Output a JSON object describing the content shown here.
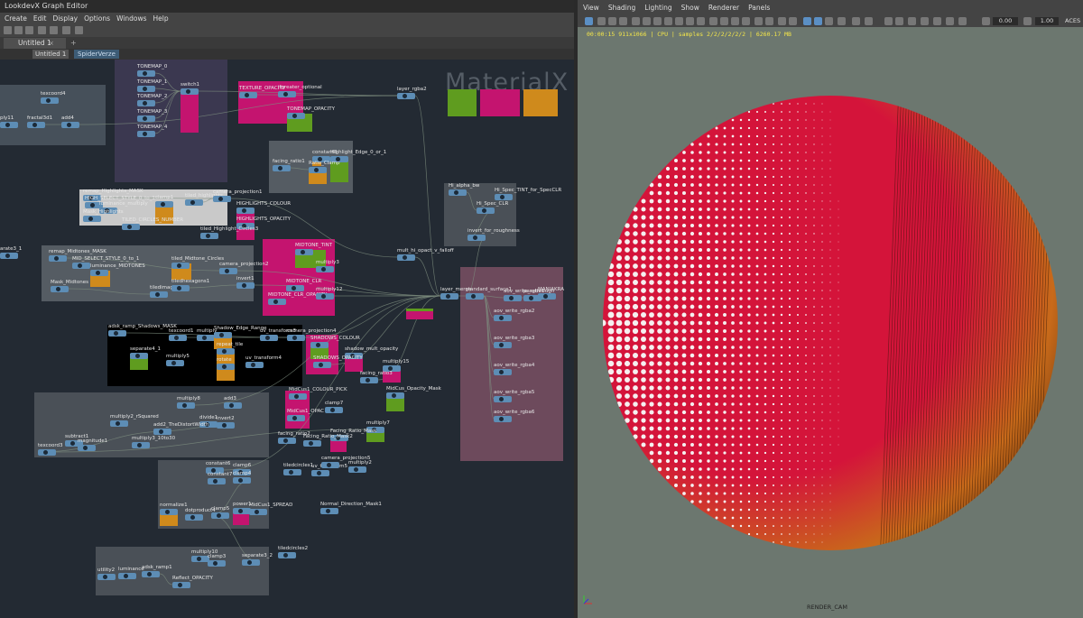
{
  "editor": {
    "window_title": "LookdevX Graph Editor",
    "menu": [
      "Create",
      "Edit",
      "Display",
      "Options",
      "Windows",
      "Help"
    ],
    "tab_label": "Untitled 1",
    "tab_close": "×",
    "tab_add": "+",
    "breadcrumb": [
      "Untitled 1",
      "SpiderVerze"
    ],
    "watermark": "MaterialX"
  },
  "graph": {
    "backdrops": [
      {
        "name": "upper-left",
        "color": "#46505a"
      },
      {
        "name": "tonemap",
        "color": "#3b3850"
      },
      {
        "name": "texture-opacity",
        "color": "#c4146f"
      },
      {
        "name": "highlight-edge",
        "color": "#555c63"
      },
      {
        "name": "highlights-mask",
        "color": "#c9c9c9"
      },
      {
        "name": "midtones",
        "color": "#555c63"
      },
      {
        "name": "midtone-tint",
        "color": "#c4146f"
      },
      {
        "name": "shadows-mask",
        "color": "#000000"
      },
      {
        "name": "shadows-colour",
        "color": "#c4146f"
      },
      {
        "name": "multiply-group",
        "color": "#4a5057"
      },
      {
        "name": "midcus-colour",
        "color": "#c4146f"
      },
      {
        "name": "constant-group",
        "color": "#4a5057"
      },
      {
        "name": "spec-group",
        "color": "#4a5057"
      },
      {
        "name": "aov-group",
        "color": "#6d4a5c"
      },
      {
        "name": "reflect-group",
        "color": "#4a5057"
      }
    ],
    "nodes": [
      {
        "label": "texcoord4"
      },
      {
        "label": "ply11"
      },
      {
        "label": "fractal3d1"
      },
      {
        "label": "add4"
      },
      {
        "label": "TONEMAP_0"
      },
      {
        "label": "TONEMAP_1"
      },
      {
        "label": "TONEMAP_2"
      },
      {
        "label": "TONEMAP_3"
      },
      {
        "label": "TONEMAP_4"
      },
      {
        "label": "switch1"
      },
      {
        "label": "TEXTURE_OPACITY"
      },
      {
        "label": "ifgreater_optional"
      },
      {
        "label": "TONEMAP_OPACITY"
      },
      {
        "label": "layer_rgba2"
      },
      {
        "label": "constant8"
      },
      {
        "label": "Highlight_Edge_0_or_1"
      },
      {
        "label": "facing_ratio1"
      },
      {
        "label": "Ratio_Clamp"
      },
      {
        "label": "remap_Highlights_MASK"
      },
      {
        "label": "HIGH_SELECT_STYLE_0_to_1"
      },
      {
        "label": "luminance_multiply"
      },
      {
        "label": "clamp1"
      },
      {
        "label": "Mask_Highlights"
      },
      {
        "label": "TILED_CIRCLES_NUMBER"
      },
      {
        "label": "tiled_highlights"
      },
      {
        "label": "camera_projection1"
      },
      {
        "label": "HIGHLIGHTS_COLOUR"
      },
      {
        "label": "HIGHLIGHTS_OPACITY"
      },
      {
        "label": "tiled_Highlight_Circles3"
      },
      {
        "label": "Hi_alpha_bw"
      },
      {
        "label": "Hi_Spec_TINT_for_SpecCLR"
      },
      {
        "label": "Hi_Spec_CLR"
      },
      {
        "label": "invert_for_roughness"
      },
      {
        "label": "arate3_1"
      },
      {
        "label": "remap_Midtones_MASK"
      },
      {
        "label": "MID_SELECT_STYLE_0_to_1"
      },
      {
        "label": "luminance_MIDTONES"
      },
      {
        "label": "tiled_Midtone_Circles"
      },
      {
        "label": "camera_projection2"
      },
      {
        "label": "Mask_Midtones"
      },
      {
        "label": "tiledimage1"
      },
      {
        "label": "tiledhexagons1"
      },
      {
        "label": "invert1"
      },
      {
        "label": "MIDTONE_TINT"
      },
      {
        "label": "multiply3"
      },
      {
        "label": "MIDTONE_CLR"
      },
      {
        "label": "MIDTONE_CLR_OPACITY"
      },
      {
        "label": "multiply12"
      },
      {
        "label": "mult_hi_opact_v_falloff"
      },
      {
        "label": "layer_merge"
      },
      {
        "label": "standard_surface1"
      },
      {
        "label": "aov_write_rgba1"
      },
      {
        "label": "passthrough"
      },
      {
        "label": "MANIAKRA"
      },
      {
        "label": "aov_write_rgba2"
      },
      {
        "label": "aov_write_rgba3"
      },
      {
        "label": "aov_write_rgba4"
      },
      {
        "label": "aov_write_rgba5"
      },
      {
        "label": "aov_write_rgba6"
      },
      {
        "label": "adsk_ramp_Shadows_MASK"
      },
      {
        "label": "texcoord1"
      },
      {
        "label": "multiply"
      },
      {
        "label": "Shadow_Edge_Range"
      },
      {
        "label": "repeat_tile"
      },
      {
        "label": "uv_transform3"
      },
      {
        "label": "camera_projection4"
      },
      {
        "label": "separate4_1"
      },
      {
        "label": "multiply5"
      },
      {
        "label": "rotate"
      },
      {
        "label": "uv_transform4"
      },
      {
        "label": "SHADOWS_COLOUR"
      },
      {
        "label": "shadow_mult_opacity"
      },
      {
        "label": "SHADOWS_OPACITY"
      },
      {
        "label": "multiply15"
      },
      {
        "label": "facing_ratio3"
      },
      {
        "label": "MidCus_Opacity_Mask"
      },
      {
        "label": "multiply8"
      },
      {
        "label": "add3"
      },
      {
        "label": "multiply2_rSquared"
      },
      {
        "label": "divide1"
      },
      {
        "label": "invert2"
      },
      {
        "label": "add2_TheDistortWidth"
      },
      {
        "label": "subtract1"
      },
      {
        "label": "magnitude1"
      },
      {
        "label": "multiply3_10to30"
      },
      {
        "label": "texcoord3"
      },
      {
        "label": "MidCus1_COLOUR_PICK"
      },
      {
        "label": "clamp7"
      },
      {
        "label": "MidCus1_OPAC"
      },
      {
        "label": "multiply7"
      },
      {
        "label": "Facing_Ratio_Mask"
      },
      {
        "label": "facing_ratio2"
      },
      {
        "label": "Facing_Ratio_Mask2"
      },
      {
        "label": "constant6"
      },
      {
        "label": "clamp6"
      },
      {
        "label": "constant7"
      },
      {
        "label": "clamp4"
      },
      {
        "label": "tiledcircles1"
      },
      {
        "label": "uv_transform5"
      },
      {
        "label": "camera_projection5"
      },
      {
        "label": "multiply2"
      },
      {
        "label": "normalize1"
      },
      {
        "label": "dotproduct4"
      },
      {
        "label": "clamp5"
      },
      {
        "label": "power1"
      },
      {
        "label": "MidCus1_SPREAD"
      },
      {
        "label": "Normal_Direction_Mask1"
      },
      {
        "label": "multiply10"
      },
      {
        "label": "clamp3"
      },
      {
        "label": "separate3_2"
      },
      {
        "label": "tiledcircles2"
      },
      {
        "label": "utility2"
      },
      {
        "label": "luminance"
      },
      {
        "label": "adsk_ramp1"
      },
      {
        "label": "Reflect_OPACITY"
      }
    ],
    "swatches": [
      {
        "name": "green",
        "color": "#5f9c1f"
      },
      {
        "name": "magenta",
        "color": "#c4146f"
      },
      {
        "name": "orange",
        "color": "#cf8a1c"
      },
      {
        "name": "yellow",
        "color": "#f0de12"
      }
    ]
  },
  "viewport": {
    "menu": [
      "View",
      "Shading",
      "Lighting",
      "Show",
      "Renderer",
      "Panels"
    ],
    "exposure": "0.00",
    "gamma": "1.00",
    "color_space": "ACES",
    "hud": "00:00:15  911x1066  | CPU  | samples 2/2/2/2/2/2  | 6260.17 MB",
    "camera": "RENDER_CAM",
    "colors": {
      "sphere_red": "#d4143a",
      "sphere_orange": "#c86a1a",
      "background": "#6c776f",
      "hud_text": "#f4e64a"
    }
  }
}
